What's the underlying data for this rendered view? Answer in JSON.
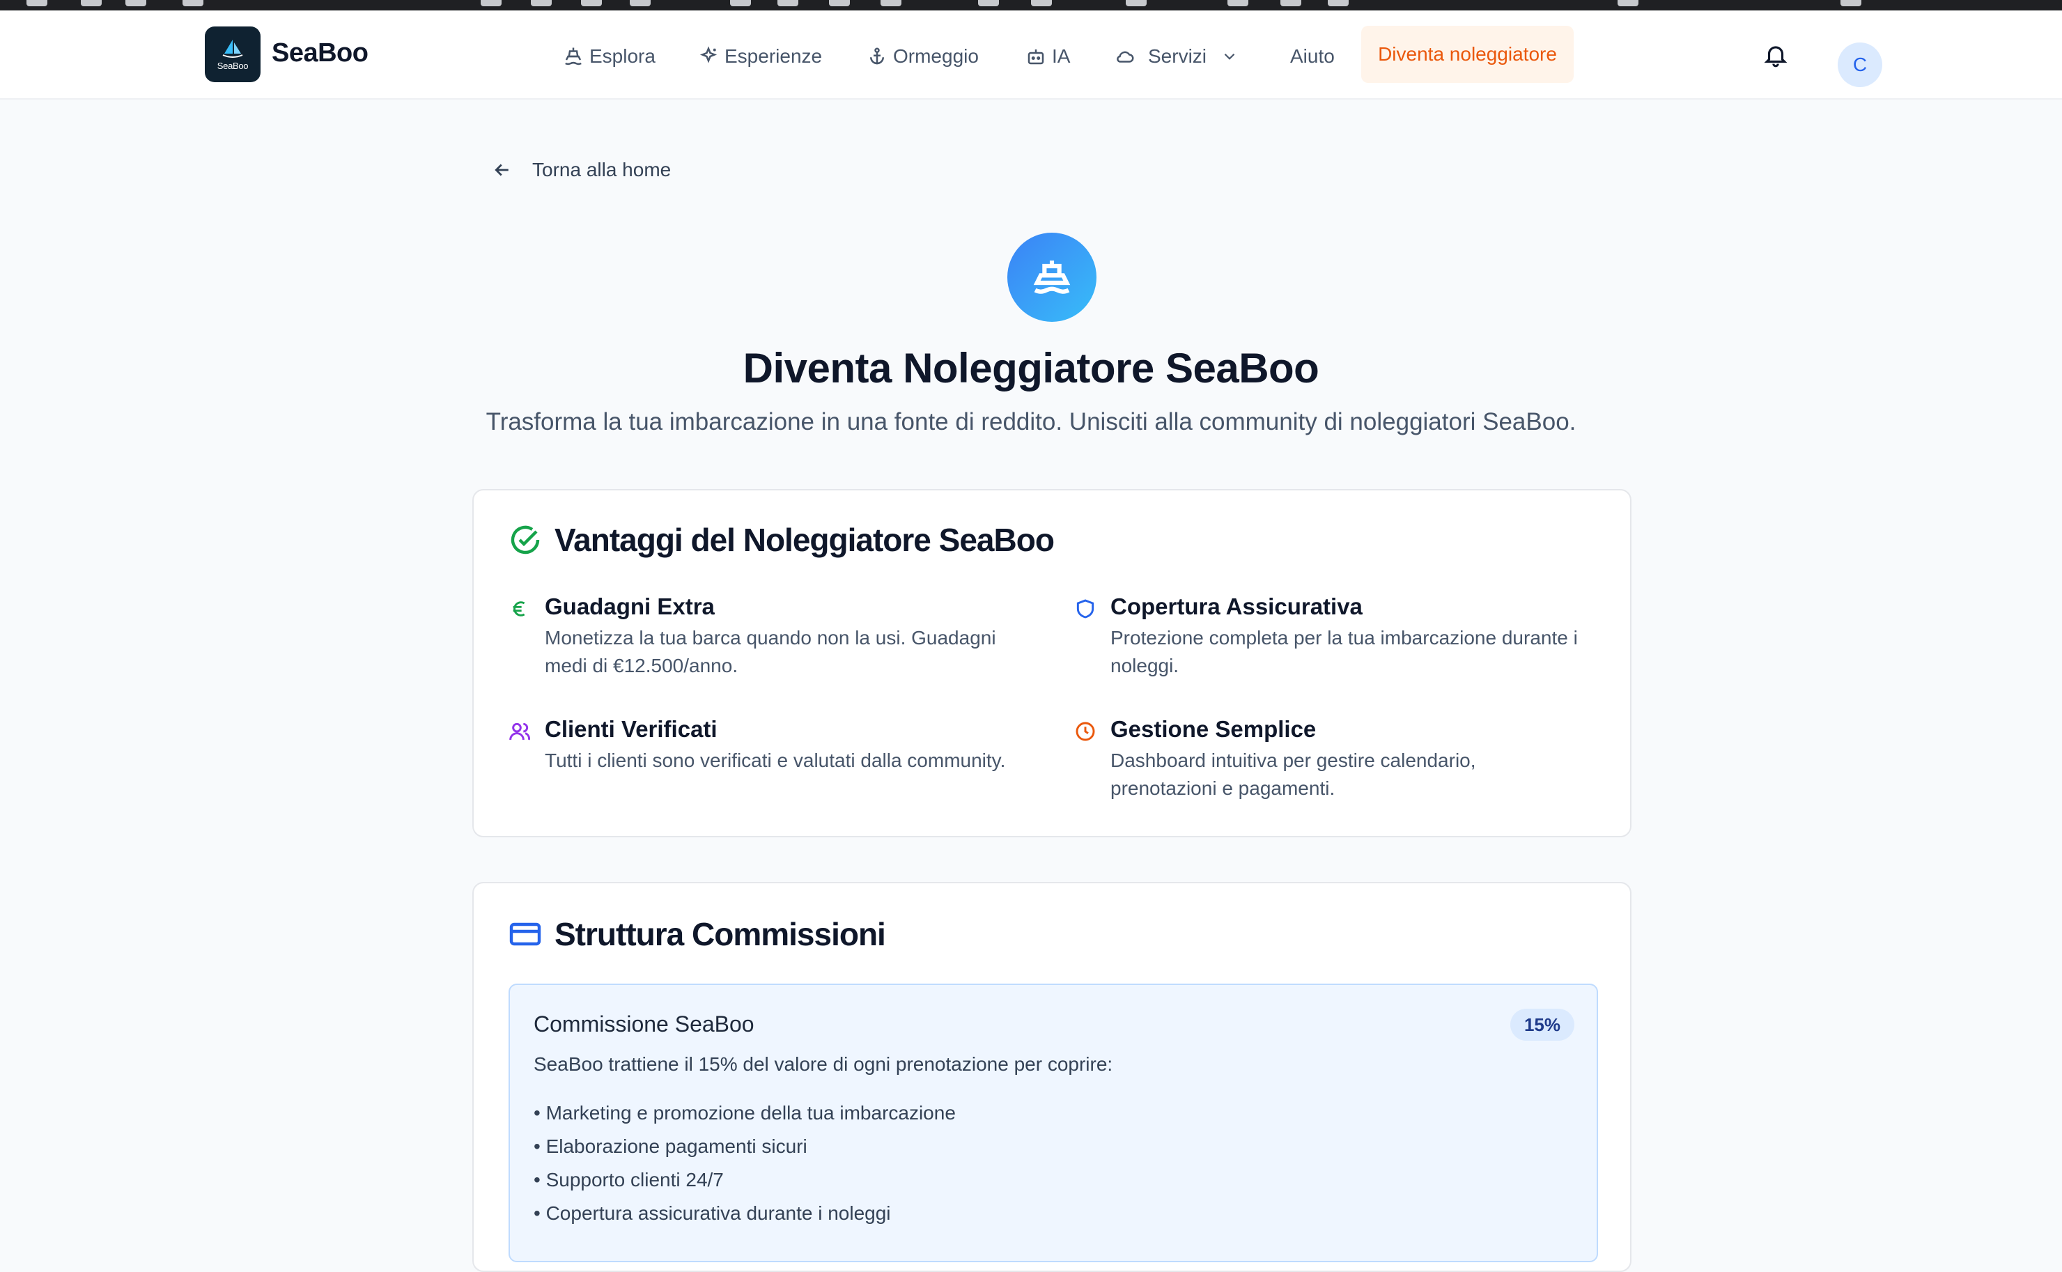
{
  "navbar": {
    "brand": "SeaBoo",
    "logo_text": "SeaBoo",
    "items": [
      {
        "label": "Esplora",
        "icon": "ship-icon"
      },
      {
        "label": "Esperienze",
        "icon": "sparkles-icon"
      },
      {
        "label": "Ormeggio",
        "icon": "anchor-icon"
      },
      {
        "label": "IA",
        "icon": "bot-icon"
      },
      {
        "label": "Servizi",
        "icon": "cloud-icon"
      },
      {
        "label": "Aiuto"
      }
    ],
    "cta": "Diventa noleggiatore",
    "avatar_initial": "C"
  },
  "back_link": "Torna alla home",
  "hero": {
    "title": "Diventa Noleggiatore SeaBoo",
    "subtitle": "Trasforma la tua imbarcazione in una fonte di reddito. Unisciti alla community di noleggiatori SeaBoo."
  },
  "benefits": {
    "title": "Vantaggi del Noleggiatore SeaBoo",
    "items": [
      {
        "title": "Guadagni Extra",
        "desc": "Monetizza la tua barca quando non la usi. Guadagni medi di €12.500/anno.",
        "icon": "euro-icon",
        "color": "#16a34a"
      },
      {
        "title": "Copertura Assicurativa",
        "desc": "Protezione completa per la tua imbarcazione durante i noleggi.",
        "icon": "shield-icon",
        "color": "#2563eb"
      },
      {
        "title": "Clienti Verificati",
        "desc": "Tutti i clienti sono verificati e valutati dalla community.",
        "icon": "users-icon",
        "color": "#9333ea"
      },
      {
        "title": "Gestione Semplice",
        "desc": "Dashboard intuitiva per gestire calendario, prenotazioni e pagamenti.",
        "icon": "clock-icon",
        "color": "#ea580c"
      }
    ]
  },
  "commissions": {
    "title": "Struttura Commissioni",
    "box_title": "Commissione SeaBoo",
    "badge": "15%",
    "desc": "SeaBoo trattiene il 15% del valore di ogni prenotazione per coprire:",
    "list": [
      "• Marketing e promozione della tua imbarcazione",
      "• Elaborazione pagamenti sicuri",
      "• Supporto clienti 24/7",
      "• Copertura assicurativa durante i noleggi"
    ]
  }
}
